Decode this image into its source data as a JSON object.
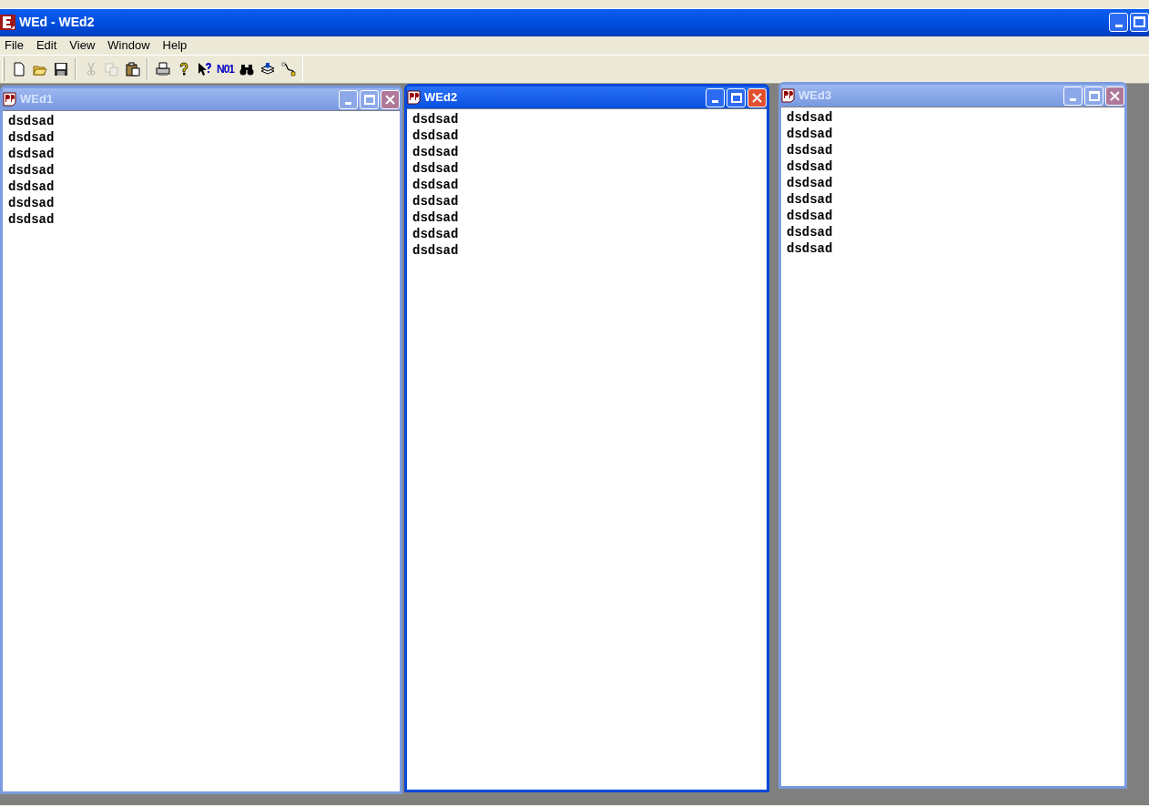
{
  "window": {
    "title": "WEd - WEd2"
  },
  "menu": [
    {
      "label": "File"
    },
    {
      "label": "Edit"
    },
    {
      "label": "View"
    },
    {
      "label": "Window"
    },
    {
      "label": "Help"
    }
  ],
  "toolbar": [
    [
      {
        "disabled": false
      },
      {
        "disabled": false
      },
      {
        "disabled": false
      }
    ],
    [
      {
        "disabled": true
      },
      {
        "disabled": true
      },
      {
        "disabled": false
      }
    ],
    [
      {
        "disabled": false
      },
      {
        "disabled": false
      },
      {
        "disabled": false
      },
      {
        "disabled": false,
        "label": "N01"
      },
      {
        "disabled": false
      },
      {
        "disabled": false
      },
      {
        "disabled": false
      }
    ]
  ],
  "documents": [
    {
      "title": "WEd1",
      "active": false,
      "lines": [
        "dsdsad",
        "dsdsad",
        "dsdsad",
        "dsdsad",
        "dsdsad",
        "dsdsad",
        "dsdsad"
      ]
    },
    {
      "title": "WEd2",
      "active": true,
      "lines": [
        "dsdsad",
        "dsdsad",
        "dsdsad",
        "dsdsad",
        "dsdsad",
        "dsdsad",
        "dsdsad",
        "dsdsad",
        "dsdsad"
      ]
    },
    {
      "title": "WEd3",
      "active": false,
      "lines": [
        "dsdsad",
        "dsdsad",
        "dsdsad",
        "dsdsad",
        "dsdsad",
        "dsdsad",
        "dsdsad",
        "dsdsad",
        "dsdsad"
      ]
    }
  ]
}
